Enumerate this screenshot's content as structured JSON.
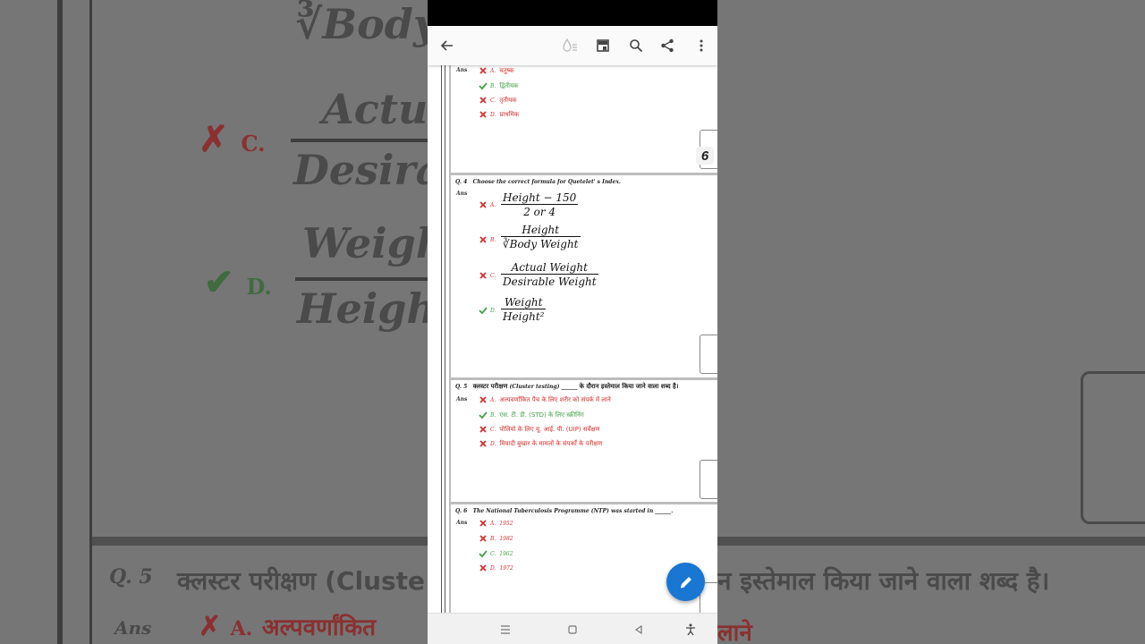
{
  "background": {
    "formula_body": "Body",
    "formula_actual": "Actua",
    "formula_desirable": "Desira",
    "formula_weight": "Weigh",
    "formula_height": "Height",
    "opt_c": "C.",
    "opt_d": "D.",
    "q_no": "Q. 5",
    "q_text_left": "क्लस्टर परीक्षण (Cluste",
    "q_text_right": "न इस्तेमाल किया जाने वाला शब्द है।",
    "ans_label": "Ans",
    "opt_a": "A.",
    "opt_a_text": "अल्पवर्णांकित",
    "opt_a_tail": "लाने"
  },
  "appbar": {
    "back_icon": "arrow-left-icon",
    "icons": [
      "reading-mode-icon",
      "bookmark-icon",
      "search-icon",
      "share-icon",
      "more-vert-icon"
    ]
  },
  "ans_label": "Ans",
  "q3": {
    "options": [
      {
        "label": "A.",
        "text": "चतुष्क",
        "correct": false
      },
      {
        "label": "B.",
        "text": "द्वितीयक",
        "correct": true
      },
      {
        "label": "C.",
        "text": "तृतीयक",
        "correct": false
      },
      {
        "label": "D.",
        "text": "प्राथमिक",
        "correct": false
      }
    ]
  },
  "page_badge": "6",
  "q4": {
    "number": "Q. 4",
    "text": "Choose the correct formula for Quetelet' s Index.",
    "options": [
      {
        "label": "A.",
        "num": "Height − 150",
        "den": "2 or 4",
        "correct": false
      },
      {
        "label": "B.",
        "num": "Height",
        "den": "∛Body Weight",
        "correct": false
      },
      {
        "label": "C.",
        "num": "Actual Weight",
        "den": "Desirable Weight",
        "correct": false
      },
      {
        "label": "D.",
        "num": "Weight",
        "den": "Height²",
        "correct": true
      }
    ]
  },
  "q5": {
    "number": "Q. 5",
    "text_hi_1": "क्लस्टर परीक्षण",
    "text_en": "(Cluster testing) ______",
    "text_hi_2": "के दौरान इस्तेमाल किया जाने वाला शब्द है।",
    "options": [
      {
        "label": "A.",
        "text": "अल्पवर्णांकित पैच के लिए शरीर को संपर्क में लाने",
        "correct": false
      },
      {
        "label": "B.",
        "text": "एस. टी. डी. (STD) के लिए स्क्रीनिंग",
        "correct": true
      },
      {
        "label": "C.",
        "text": "पोलियो के लिए यू. आई. पी. (UIP) सर्वेक्षण",
        "correct": false
      },
      {
        "label": "D.",
        "text": "मियादी बुखार के मामलों के संपर्कों के परीक्षण",
        "correct": false
      }
    ]
  },
  "q6": {
    "number": "Q. 6",
    "text": "The National Tuberculosis Programme (NTP) was started in ______.",
    "options": [
      {
        "label": "A.",
        "text": "1952",
        "correct": false
      },
      {
        "label": "B.",
        "text": "1982",
        "correct": false
      },
      {
        "label": "C.",
        "text": "1962",
        "correct": true
      },
      {
        "label": "D.",
        "text": "1972",
        "correct": false
      }
    ]
  },
  "fab_icon": "pencil-edit-icon",
  "navbar": [
    "menu-nav-icon",
    "home-nav-icon",
    "back-nav-icon",
    "accessibility-icon"
  ]
}
